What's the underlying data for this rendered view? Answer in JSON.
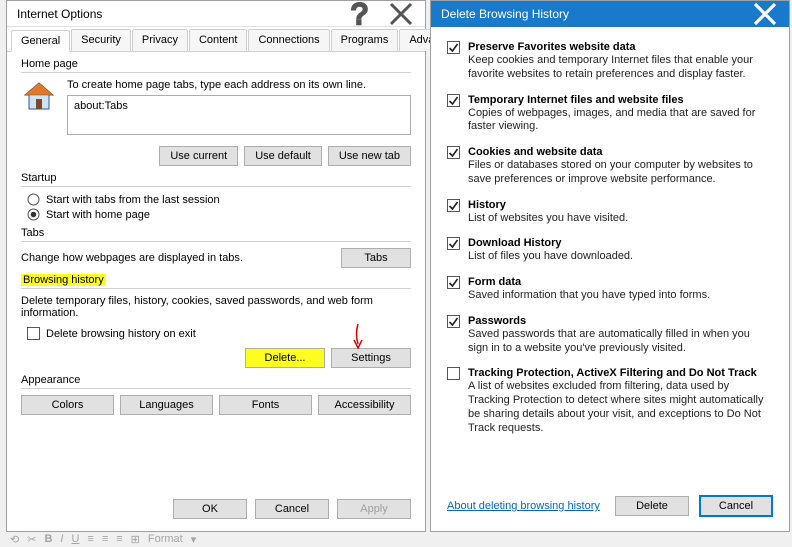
{
  "io": {
    "title": "Internet Options",
    "tabs": [
      "General",
      "Security",
      "Privacy",
      "Content",
      "Connections",
      "Programs",
      "Advanced"
    ],
    "homepage": {
      "label": "Home page",
      "instruction": "To create home page tabs, type each address on its own line.",
      "value": "about:Tabs",
      "use_current": "Use current",
      "use_default": "Use default",
      "use_new_tab": "Use new tab"
    },
    "startup": {
      "label": "Startup",
      "opt_last": "Start with tabs from the last session",
      "opt_home": "Start with home page"
    },
    "tabssec": {
      "label": "Tabs",
      "text": "Change how webpages are displayed in tabs.",
      "button": "Tabs"
    },
    "history": {
      "label": "Browsing history",
      "text": "Delete temporary files, history, cookies, saved passwords, and web form information.",
      "checkbox": "Delete browsing history on exit",
      "delete": "Delete...",
      "settings": "Settings"
    },
    "appearance": {
      "label": "Appearance",
      "colors": "Colors",
      "languages": "Languages",
      "fonts": "Fonts",
      "accessibility": "Accessibility"
    },
    "footer": {
      "ok": "OK",
      "cancel": "Cancel",
      "apply": "Apply"
    }
  },
  "dh": {
    "title": "Delete Browsing History",
    "items": [
      {
        "checked": true,
        "label": "Preserve Favorites website data",
        "desc": "Keep cookies and temporary Internet files that enable your favorite websites to retain preferences and display faster."
      },
      {
        "checked": true,
        "label": "Temporary Internet files and website files",
        "desc": "Copies of webpages, images, and media that are saved for faster viewing."
      },
      {
        "checked": true,
        "label": "Cookies and website data",
        "desc": "Files or databases stored on your computer by websites to save preferences or improve website performance."
      },
      {
        "checked": true,
        "label": "History",
        "desc": "List of websites you have visited."
      },
      {
        "checked": true,
        "label": "Download History",
        "desc": "List of files you have downloaded."
      },
      {
        "checked": true,
        "label": "Form data",
        "desc": "Saved information that you have typed into forms."
      },
      {
        "checked": true,
        "label": "Passwords",
        "desc": "Saved passwords that are automatically filled in when you sign in to a website you've previously visited."
      },
      {
        "checked": false,
        "label": "Tracking Protection, ActiveX Filtering and Do Not Track",
        "desc": "A list of websites excluded from filtering, data used by Tracking Protection to detect where sites might automatically be sharing details about your visit, and exceptions to Do Not Track requests."
      }
    ],
    "link": "About deleting browsing history",
    "delete": "Delete",
    "cancel": "Cancel"
  },
  "strip": {
    "format": "Format"
  }
}
